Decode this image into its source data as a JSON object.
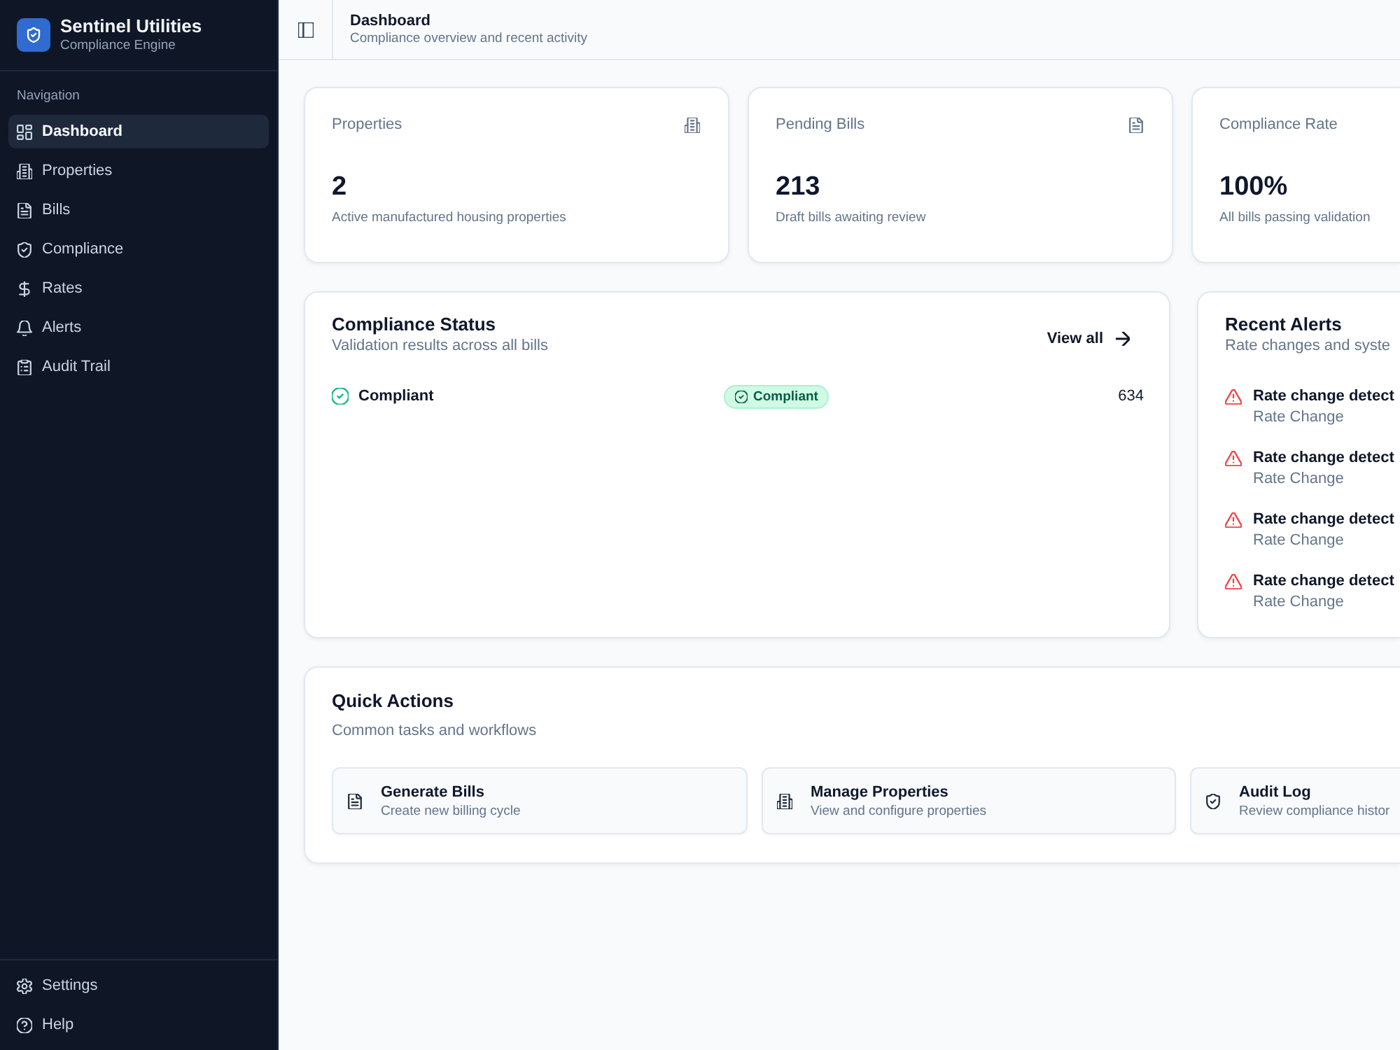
{
  "sidebar": {
    "brand": {
      "name": "Sentinel Utilities",
      "tagline": "Compliance Engine"
    },
    "section_label": "Navigation",
    "items": [
      {
        "label": "Dashboard",
        "selected": true
      },
      {
        "label": "Properties",
        "selected": false
      },
      {
        "label": "Bills",
        "selected": false
      },
      {
        "label": "Compliance",
        "selected": false
      },
      {
        "label": "Rates",
        "selected": false
      },
      {
        "label": "Alerts",
        "selected": false
      },
      {
        "label": "Audit Trail",
        "selected": false
      }
    ],
    "footer_items": [
      {
        "label": "Settings",
        "selected": false
      },
      {
        "label": "Help",
        "selected": false
      }
    ]
  },
  "header": {
    "title": "Dashboard",
    "subtitle": "Compliance overview and recent activity"
  },
  "stats": [
    {
      "label": "Properties",
      "value": "2",
      "caption": "Active manufactured housing properties"
    },
    {
      "label": "Pending Bills",
      "value": "213",
      "caption": "Draft bills awaiting review"
    },
    {
      "label": "Compliance Rate",
      "value": "100%",
      "caption": "All bills passing validation"
    }
  ],
  "compliance_status": {
    "title": "Compliance Status",
    "subtitle": "Validation results across all bills",
    "link": "View all",
    "rows": [
      {
        "label": "Compliant",
        "badge": "Compliant",
        "count": "634"
      }
    ]
  },
  "recent_alerts": {
    "title": "Recent Alerts",
    "subtitle": "Rate changes and syste",
    "items": [
      {
        "title": "Rate change detect",
        "type": "Rate Change"
      },
      {
        "title": "Rate change detect",
        "type": "Rate Change"
      },
      {
        "title": "Rate change detect",
        "type": "Rate Change"
      },
      {
        "title": "Rate change detect",
        "type": "Rate Change"
      }
    ]
  },
  "quick_actions": {
    "title": "Quick Actions",
    "subtitle": "Common tasks and workflows",
    "actions": [
      {
        "title": "Generate Bills",
        "description": "Create new billing cycle"
      },
      {
        "title": "Manage Properties",
        "description": "View and configure properties"
      },
      {
        "title": "Audit Log",
        "description": "Review compliance histor"
      }
    ]
  }
}
